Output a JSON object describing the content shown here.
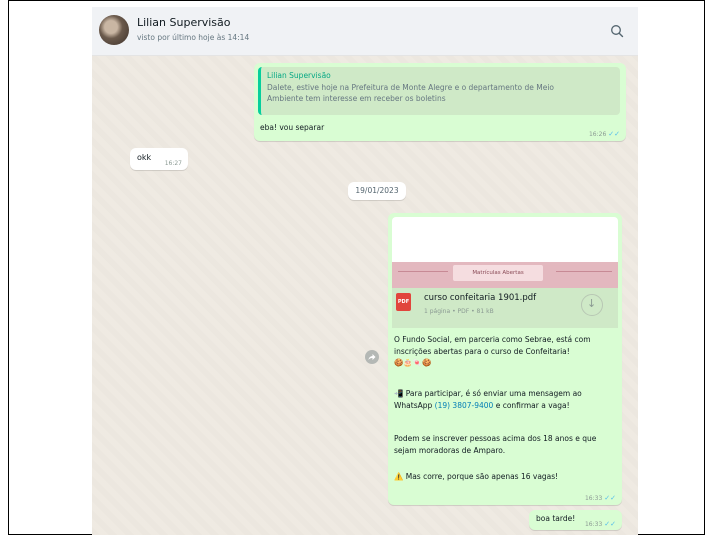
{
  "contact": {
    "name": "Lilian Supervisão",
    "last_seen": "visto por último hoje às 14:14"
  },
  "messages": {
    "m1": {
      "quote_author": "Lilian Supervisão",
      "quote_line1": "Dalete, estive hoje na Prefeitura de Monte Alegre e o departamento de Meio",
      "quote_line2": "Ambiente tem interesse em receber os boletins",
      "text": "eba! vou separar",
      "time": "16:26"
    },
    "m2": {
      "text": "okk",
      "time": "16:27"
    },
    "date_separator": "19/01/2023",
    "m3": {
      "banner_label": "Matrículas Abertas",
      "file_name": "curso confeitaria 1901.pdf",
      "file_meta": "1 página • PDF • 81 kB",
      "pdf_label": "PDF",
      "p1": "O Fundo Social, em parceria como Sebrae, está com inscrições abertas para o curso de Confeitaria!",
      "p1_emoji": "🍪🎂🍬🍪",
      "p2_emoji": "📲",
      "p2_a": "Para participar, é só enviar uma mensagem ao WhatsApp",
      "p2_link": "(19) 3807-9400",
      "p2_b": "e confirmar a vaga!",
      "p3": "Podem se inscrever pessoas acima dos 18 anos e que sejam moradoras de Amparo.",
      "p4_emoji": "⚠️",
      "p4": "Mas corre, porque são apenas 16 vagas!",
      "time": "16:33"
    },
    "m4": {
      "text": "boa tarde!",
      "time": "16:33"
    },
    "tick_glyph": "✓✓"
  }
}
